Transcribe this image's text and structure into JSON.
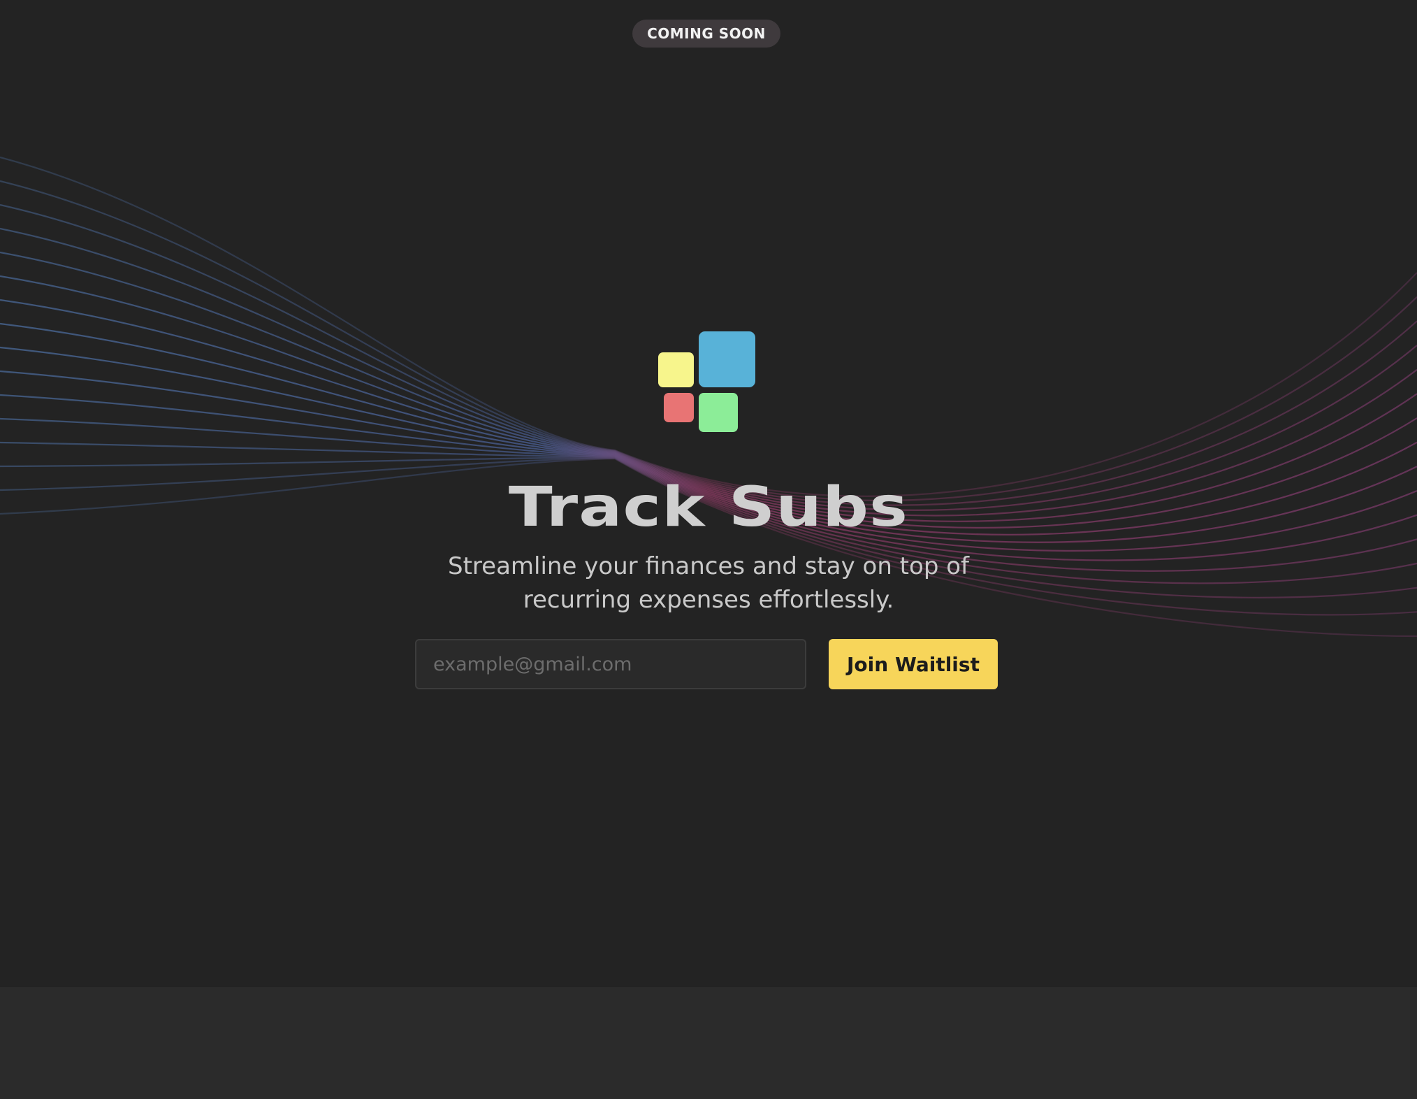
{
  "badge": {
    "label": "COMING SOON"
  },
  "brand": {
    "title": "Track Subs",
    "tagline_line1": "Streamline your finances and stay on top of",
    "tagline_line2": "recurring expenses effortlessly.",
    "logo_colors": [
      "#f7f58c",
      "#58b2d8",
      "#e87474",
      "#8ced98"
    ]
  },
  "signup": {
    "email_placeholder": "example@gmail.com",
    "email_value": "",
    "submit_label": "Join Waitlist"
  },
  "colors": {
    "background": "#232323",
    "footer_band": "#2b2b2b",
    "badge_bg": "#3f3a3d",
    "accent": "#f7d55a",
    "wave_blue": "#4a6a9a",
    "wave_pink": "#8a3a62"
  }
}
